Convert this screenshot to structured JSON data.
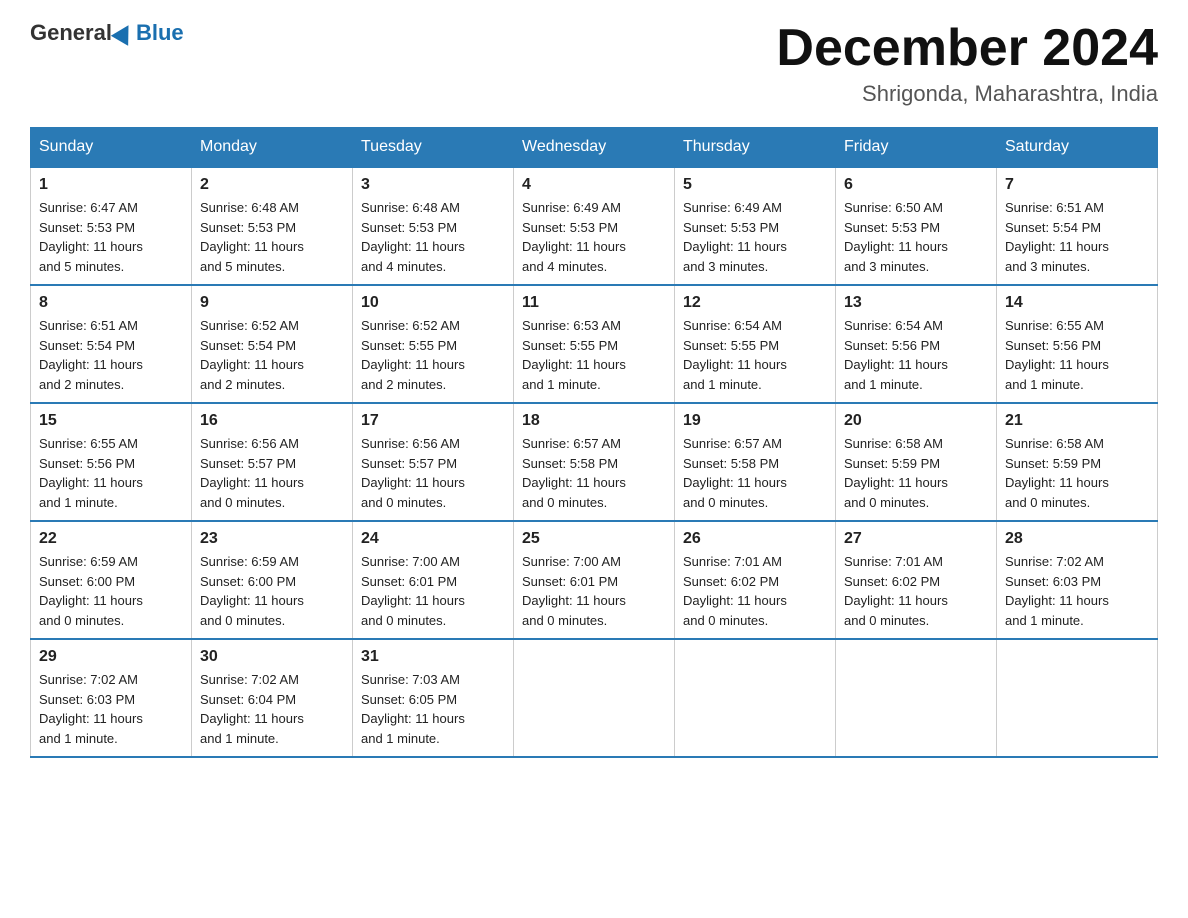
{
  "logo": {
    "general": "General",
    "blue": "Blue"
  },
  "title": {
    "month_year": "December 2024",
    "location": "Shrigonda, Maharashtra, India"
  },
  "days_of_week": [
    "Sunday",
    "Monday",
    "Tuesday",
    "Wednesday",
    "Thursday",
    "Friday",
    "Saturday"
  ],
  "weeks": [
    [
      {
        "day": "1",
        "sunrise": "6:47 AM",
        "sunset": "5:53 PM",
        "daylight": "11 hours and 5 minutes."
      },
      {
        "day": "2",
        "sunrise": "6:48 AM",
        "sunset": "5:53 PM",
        "daylight": "11 hours and 5 minutes."
      },
      {
        "day": "3",
        "sunrise": "6:48 AM",
        "sunset": "5:53 PM",
        "daylight": "11 hours and 4 minutes."
      },
      {
        "day": "4",
        "sunrise": "6:49 AM",
        "sunset": "5:53 PM",
        "daylight": "11 hours and 4 minutes."
      },
      {
        "day": "5",
        "sunrise": "6:49 AM",
        "sunset": "5:53 PM",
        "daylight": "11 hours and 3 minutes."
      },
      {
        "day": "6",
        "sunrise": "6:50 AM",
        "sunset": "5:53 PM",
        "daylight": "11 hours and 3 minutes."
      },
      {
        "day": "7",
        "sunrise": "6:51 AM",
        "sunset": "5:54 PM",
        "daylight": "11 hours and 3 minutes."
      }
    ],
    [
      {
        "day": "8",
        "sunrise": "6:51 AM",
        "sunset": "5:54 PM",
        "daylight": "11 hours and 2 minutes."
      },
      {
        "day": "9",
        "sunrise": "6:52 AM",
        "sunset": "5:54 PM",
        "daylight": "11 hours and 2 minutes."
      },
      {
        "day": "10",
        "sunrise": "6:52 AM",
        "sunset": "5:55 PM",
        "daylight": "11 hours and 2 minutes."
      },
      {
        "day": "11",
        "sunrise": "6:53 AM",
        "sunset": "5:55 PM",
        "daylight": "11 hours and 1 minute."
      },
      {
        "day": "12",
        "sunrise": "6:54 AM",
        "sunset": "5:55 PM",
        "daylight": "11 hours and 1 minute."
      },
      {
        "day": "13",
        "sunrise": "6:54 AM",
        "sunset": "5:56 PM",
        "daylight": "11 hours and 1 minute."
      },
      {
        "day": "14",
        "sunrise": "6:55 AM",
        "sunset": "5:56 PM",
        "daylight": "11 hours and 1 minute."
      }
    ],
    [
      {
        "day": "15",
        "sunrise": "6:55 AM",
        "sunset": "5:56 PM",
        "daylight": "11 hours and 1 minute."
      },
      {
        "day": "16",
        "sunrise": "6:56 AM",
        "sunset": "5:57 PM",
        "daylight": "11 hours and 0 minutes."
      },
      {
        "day": "17",
        "sunrise": "6:56 AM",
        "sunset": "5:57 PM",
        "daylight": "11 hours and 0 minutes."
      },
      {
        "day": "18",
        "sunrise": "6:57 AM",
        "sunset": "5:58 PM",
        "daylight": "11 hours and 0 minutes."
      },
      {
        "day": "19",
        "sunrise": "6:57 AM",
        "sunset": "5:58 PM",
        "daylight": "11 hours and 0 minutes."
      },
      {
        "day": "20",
        "sunrise": "6:58 AM",
        "sunset": "5:59 PM",
        "daylight": "11 hours and 0 minutes."
      },
      {
        "day": "21",
        "sunrise": "6:58 AM",
        "sunset": "5:59 PM",
        "daylight": "11 hours and 0 minutes."
      }
    ],
    [
      {
        "day": "22",
        "sunrise": "6:59 AM",
        "sunset": "6:00 PM",
        "daylight": "11 hours and 0 minutes."
      },
      {
        "day": "23",
        "sunrise": "6:59 AM",
        "sunset": "6:00 PM",
        "daylight": "11 hours and 0 minutes."
      },
      {
        "day": "24",
        "sunrise": "7:00 AM",
        "sunset": "6:01 PM",
        "daylight": "11 hours and 0 minutes."
      },
      {
        "day": "25",
        "sunrise": "7:00 AM",
        "sunset": "6:01 PM",
        "daylight": "11 hours and 0 minutes."
      },
      {
        "day": "26",
        "sunrise": "7:01 AM",
        "sunset": "6:02 PM",
        "daylight": "11 hours and 0 minutes."
      },
      {
        "day": "27",
        "sunrise": "7:01 AM",
        "sunset": "6:02 PM",
        "daylight": "11 hours and 0 minutes."
      },
      {
        "day": "28",
        "sunrise": "7:02 AM",
        "sunset": "6:03 PM",
        "daylight": "11 hours and 1 minute."
      }
    ],
    [
      {
        "day": "29",
        "sunrise": "7:02 AM",
        "sunset": "6:03 PM",
        "daylight": "11 hours and 1 minute."
      },
      {
        "day": "30",
        "sunrise": "7:02 AM",
        "sunset": "6:04 PM",
        "daylight": "11 hours and 1 minute."
      },
      {
        "day": "31",
        "sunrise": "7:03 AM",
        "sunset": "6:05 PM",
        "daylight": "11 hours and 1 minute."
      },
      null,
      null,
      null,
      null
    ]
  ],
  "labels": {
    "sunrise": "Sunrise: ",
    "sunset": "Sunset: ",
    "daylight": "Daylight: "
  }
}
